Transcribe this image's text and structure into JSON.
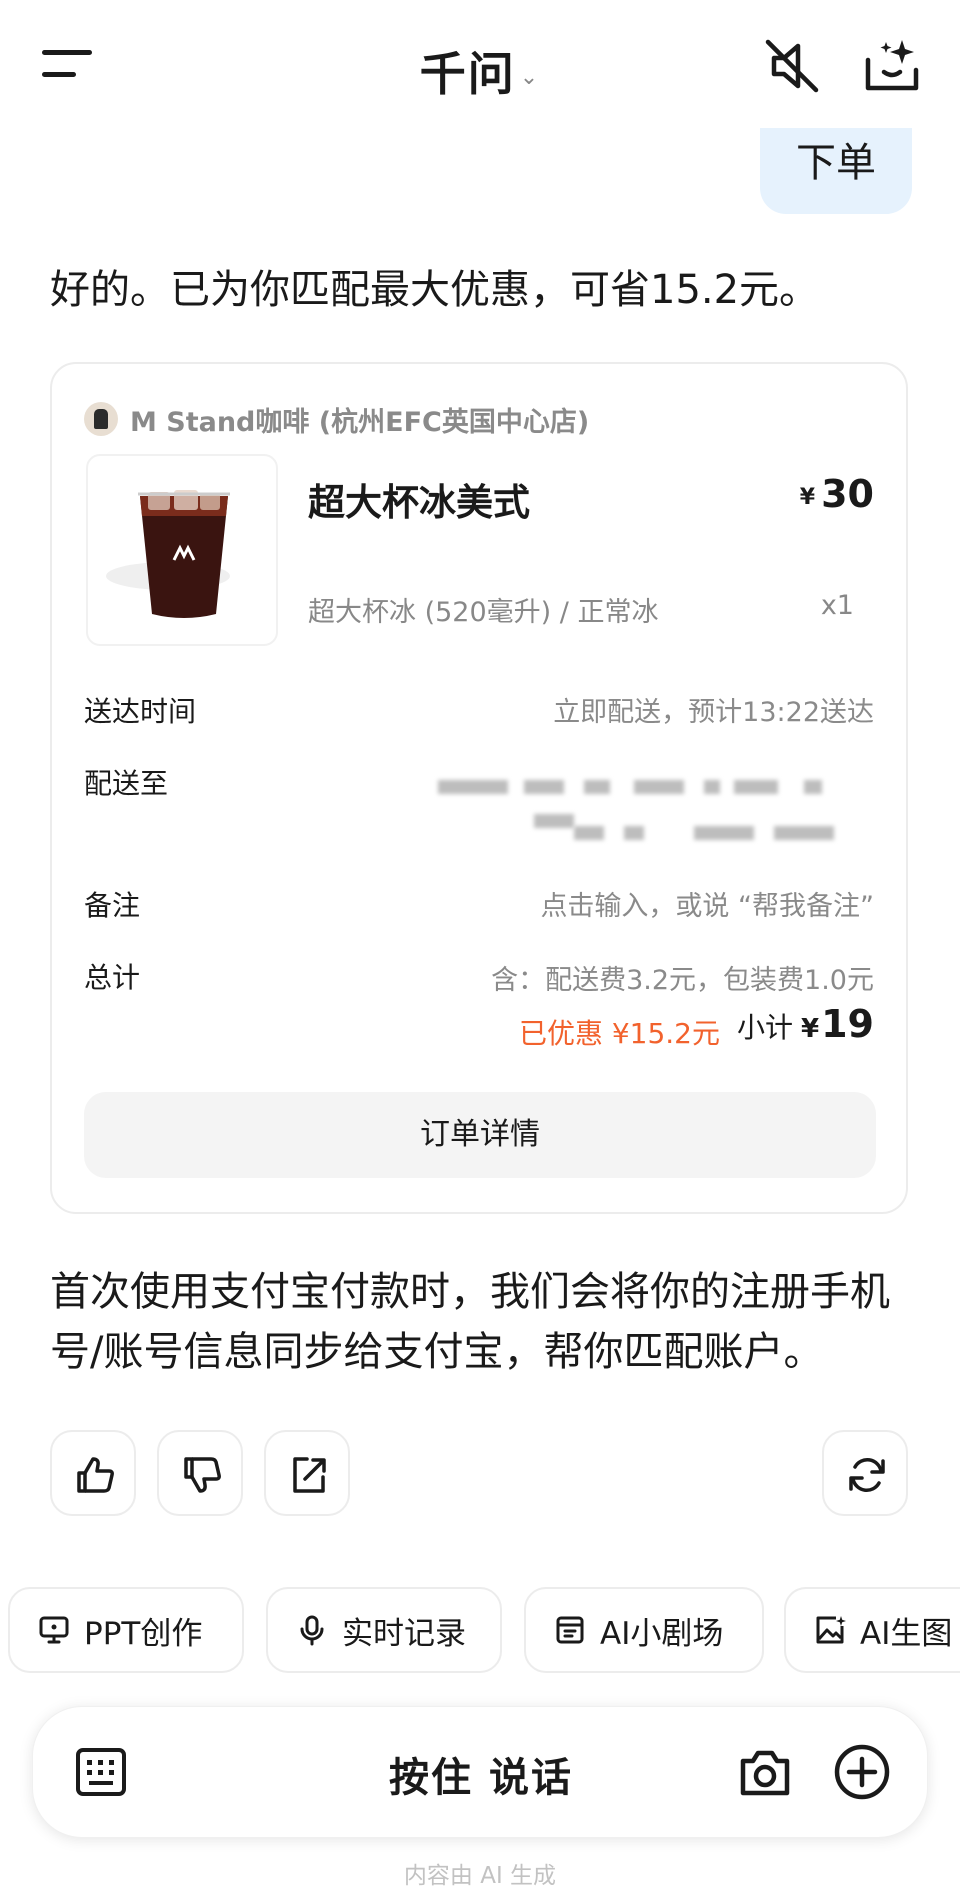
{
  "header": {
    "title": "千问",
    "title_chevron": "⌄"
  },
  "conversation": {
    "user_message": "下单",
    "assistant_reply": "好的。已为你匹配最大优惠，可省15.2元。",
    "notice": "首次使用支付宝付款时，我们会将你的注册手机号/账号信息同步给支付宝，帮你匹配账户。"
  },
  "order_card": {
    "store_name": "M Stand咖啡 (杭州EFC英国中心店)",
    "product": {
      "name": "超大杯冰美式",
      "currency": "¥",
      "price": "30",
      "spec": "超大杯冰 (520毫升) / 正常冰",
      "quantity": "x1"
    },
    "delivery_time_label": "送达时间",
    "delivery_time_value": "立即配送，预计13:22送达",
    "address_label": "配送至",
    "remark_label": "备注",
    "remark_placeholder": "点击输入，或说 “帮我备注”",
    "total_label": "总计",
    "fees_text": "含：配送费3.2元，包装费1.0元",
    "discount_text": "已优惠 ¥15.2元",
    "subtotal_label": "小计",
    "subtotal_currency": "¥",
    "subtotal_amount": "19",
    "detail_button_label": "订单详情"
  },
  "quick_chips": [
    {
      "label": "PPT创作",
      "icon": "presentation-icon"
    },
    {
      "label": "实时记录",
      "icon": "microphone-icon"
    },
    {
      "label": "AI小剧场",
      "icon": "theater-icon"
    },
    {
      "label": "AI生图",
      "icon": "image-generate-icon"
    }
  ],
  "input_bar": {
    "hold_to_talk_label": "按住 说话"
  },
  "footer_note": "内容由 AI 生成",
  "colors": {
    "user_bubble": "#e6f2fd",
    "discount": "#f2622d",
    "button_bg": "#f4f4f4"
  }
}
